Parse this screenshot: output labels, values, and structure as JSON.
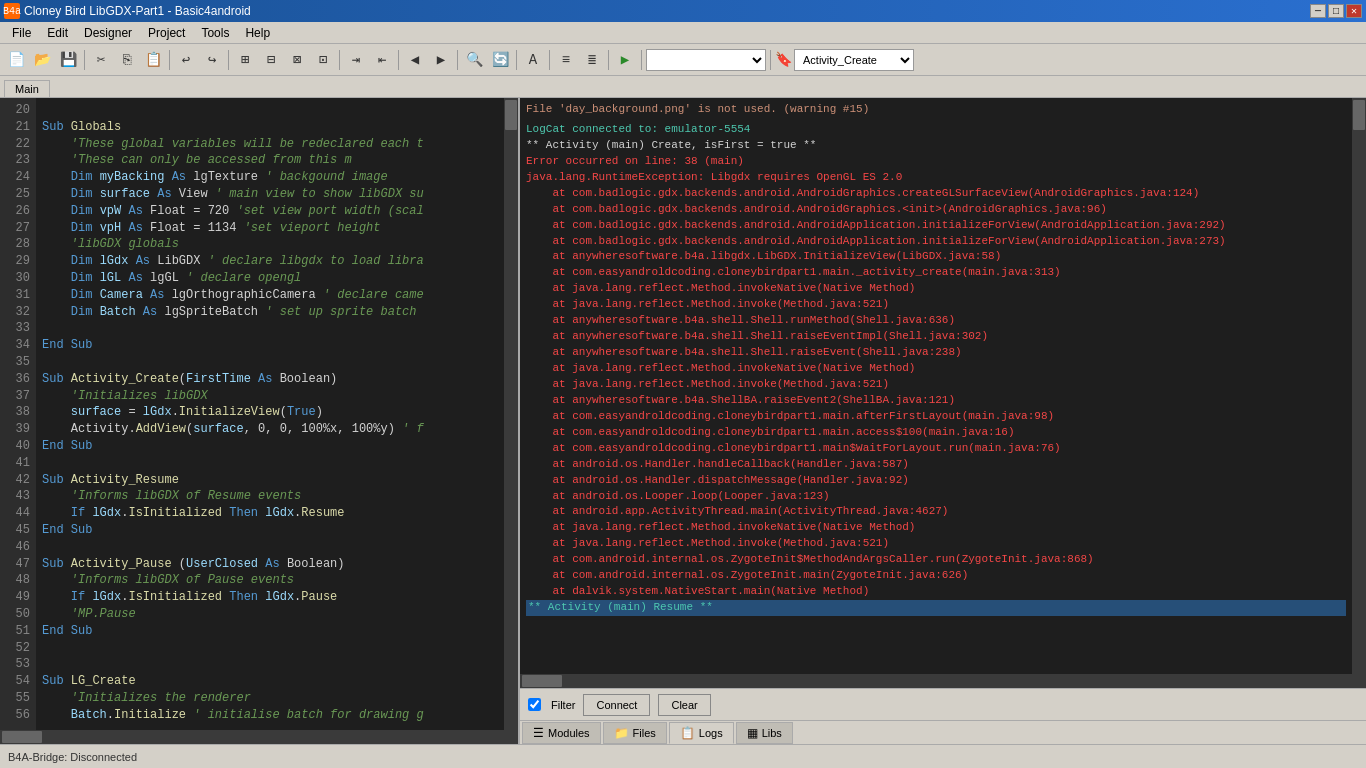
{
  "titleBar": {
    "title": "Cloney Bird LibGDX-Part1 - Basic4android",
    "icon": "B4a",
    "controls": [
      "minimize",
      "maximize",
      "close"
    ]
  },
  "menuBar": {
    "items": [
      "File",
      "Edit",
      "Designer",
      "Project",
      "Tools",
      "Help"
    ]
  },
  "toolbar": {
    "dropdowns": [
      "",
      "Activity_Create"
    ]
  },
  "tabs": {
    "items": [
      "Main"
    ]
  },
  "codeEditor": {
    "lines": [
      {
        "num": 20,
        "code": ""
      },
      {
        "num": 21,
        "code": "Sub Globals"
      },
      {
        "num": 22,
        "code": "    'These global variables will be redeclared each t"
      },
      {
        "num": 23,
        "code": "    'These can only be accessed from this m"
      },
      {
        "num": 24,
        "code": "    Dim myBacking As lgTexture ' backgound image"
      },
      {
        "num": 25,
        "code": "    Dim surface As View ' main view to show libGDX su"
      },
      {
        "num": 26,
        "code": "    Dim vpW As Float = 720 'set view port width (scal"
      },
      {
        "num": 27,
        "code": "    Dim vpH As Float = 1134 'set vieport height"
      },
      {
        "num": 28,
        "code": "    'libGDX globals"
      },
      {
        "num": 29,
        "code": "    Dim lGdx As LibGDX ' declare libgdx to load libra"
      },
      {
        "num": 30,
        "code": "    Dim lGL As lgGL ' declare opengl"
      },
      {
        "num": 31,
        "code": "    Dim Camera As lgOrthographicCamera ' declare came"
      },
      {
        "num": 32,
        "code": "    Dim Batch As lgSpriteBatch ' set up sprite batch "
      },
      {
        "num": 33,
        "code": ""
      },
      {
        "num": 34,
        "code": "End Sub"
      },
      {
        "num": 35,
        "code": ""
      },
      {
        "num": 36,
        "code": "Sub Activity_Create(FirstTime As Boolean)"
      },
      {
        "num": 37,
        "code": "    'Initializes libGDX"
      },
      {
        "num": 38,
        "code": "    surface = lGdx.InitializeView(True)"
      },
      {
        "num": 39,
        "code": "    Activity.AddView(surface, 0, 0, 100%x, 100%y) ' f"
      },
      {
        "num": 40,
        "code": "End Sub"
      },
      {
        "num": 41,
        "code": ""
      },
      {
        "num": 42,
        "code": "Sub Activity_Resume"
      },
      {
        "num": 43,
        "code": "    'Informs libGDX of Resume events"
      },
      {
        "num": 44,
        "code": "    If lGdx.IsInitialized Then lGdx.Resume"
      },
      {
        "num": 45,
        "code": "End Sub"
      },
      {
        "num": 46,
        "code": ""
      },
      {
        "num": 47,
        "code": "Sub Activity_Pause (UserClosed As Boolean)"
      },
      {
        "num": 48,
        "code": "    'Informs libGDX of Pause events"
      },
      {
        "num": 49,
        "code": "    If lGdx.IsInitialized Then lGdx.Pause"
      },
      {
        "num": 50,
        "code": "    'MP.Pause"
      },
      {
        "num": 51,
        "code": "End Sub"
      },
      {
        "num": 52,
        "code": ""
      },
      {
        "num": 53,
        "code": ""
      },
      {
        "num": 54,
        "code": "Sub LG_Create"
      },
      {
        "num": 55,
        "code": "    'Initializes the renderer"
      },
      {
        "num": 56,
        "code": "    Batch.Initialize ' initialise batch for drawing g"
      }
    ]
  },
  "logPanel": {
    "lines": [
      {
        "type": "warning",
        "text": "File 'day_background.png' is not used. (warning #15)"
      },
      {
        "type": "normal",
        "text": ""
      },
      {
        "type": "green",
        "text": "LogCat connected to: emulator-5554"
      },
      {
        "type": "normal",
        "text": "** Activity (main) Create, isFirst = true **"
      },
      {
        "type": "error",
        "text": "Error occurred on line: 38 (main)"
      },
      {
        "type": "error",
        "text": "java.lang.RuntimeException: Libgdx requires OpenGL ES 2.0"
      },
      {
        "type": "error",
        "text": "    at com.badlogic.gdx.backends.android.AndroidGraphics.createGLSurfaceView(AndroidGraphics.java:124)"
      },
      {
        "type": "error",
        "text": "    at com.badlogic.gdx.backends.android.AndroidGraphics.<init>(AndroidGraphics.java:96)"
      },
      {
        "type": "error",
        "text": "    at com.badlogic.gdx.backends.android.AndroidApplication.initializeForView(AndroidApplication.java:292)"
      },
      {
        "type": "error",
        "text": "    at com.badlogic.gdx.backends.android.AndroidApplication.initializeForView(AndroidApplication.java:273)"
      },
      {
        "type": "error",
        "text": "    at anywheresoftware.b4a.libgdx.LibGDX.InitializeView(LibGDX.java:58)"
      },
      {
        "type": "error",
        "text": "    at com.easyandroldcoding.cloneybirdpart1.main._activity_create(main.java:313)"
      },
      {
        "type": "error",
        "text": "    at java.lang.reflect.Method.invokeNative(Native Method)"
      },
      {
        "type": "error",
        "text": "    at java.lang.reflect.Method.invoke(Method.java:521)"
      },
      {
        "type": "error",
        "text": "    at anywheresoftware.b4a.shell.Shell.runMethod(Shell.java:636)"
      },
      {
        "type": "error",
        "text": "    at anywheresoftware.b4a.shell.Shell.raiseEventImpl(Shell.java:302)"
      },
      {
        "type": "error",
        "text": "    at anywheresoftware.b4a.shell.Shell.raiseEvent(Shell.java:238)"
      },
      {
        "type": "error",
        "text": "    at java.lang.reflect.Method.invokeNative(Native Method)"
      },
      {
        "type": "error",
        "text": "    at java.lang.reflect.Method.invoke(Method.java:521)"
      },
      {
        "type": "error",
        "text": "    at anywheresoftware.b4a.ShellBA.raiseEvent2(ShellBA.java:121)"
      },
      {
        "type": "error",
        "text": "    at com.easyandroldcoding.cloneybirdpart1.main.afterFirstLayout(main.java:98)"
      },
      {
        "type": "error",
        "text": "    at com.easyandroldcoding.cloneybirdpart1.main.access$100(main.java:16)"
      },
      {
        "type": "error",
        "text": "    at com.easyandroldcoding.cloneybirdpart1.main$WaitForLayout.run(main.java:76)"
      },
      {
        "type": "error",
        "text": "    at android.os.Handler.handleCallback(Handler.java:587)"
      },
      {
        "type": "error",
        "text": "    at android.os.Handler.dispatchMessage(Handler.java:92)"
      },
      {
        "type": "error",
        "text": "    at android.os.Looper.loop(Looper.java:123)"
      },
      {
        "type": "error",
        "text": "    at android.app.ActivityThread.main(ActivityThread.java:4627)"
      },
      {
        "type": "error",
        "text": "    at java.lang.reflect.Method.invokeNative(Native Method)"
      },
      {
        "type": "error",
        "text": "    at java.lang.reflect.Method.invoke(Method.java:521)"
      },
      {
        "type": "error",
        "text": "    at com.android.internal.os.ZygoteInit$MethodAndArgsCaller.run(ZygoteInit.java:868)"
      },
      {
        "type": "error",
        "text": "    at com.android.internal.os.ZygoteInit.main(ZygoteInit.java:626)"
      },
      {
        "type": "error",
        "text": "    at dalvik.system.NativeStart.main(Native Method)"
      },
      {
        "type": "highlight",
        "text": "** Activity (main) Resume **"
      }
    ]
  },
  "controls": {
    "filter_label": "Filter",
    "connect_label": "Connect",
    "clear_label": "Clear"
  },
  "bottomTabs": {
    "items": [
      {
        "label": "Modules",
        "icon": "☰"
      },
      {
        "label": "Files",
        "icon": "📁"
      },
      {
        "label": "Logs",
        "icon": "📋"
      },
      {
        "label": "Libs",
        "icon": "▦"
      }
    ],
    "active": "Logs"
  },
  "statusBar": {
    "text": "B4A-Bridge: Disconnected"
  }
}
